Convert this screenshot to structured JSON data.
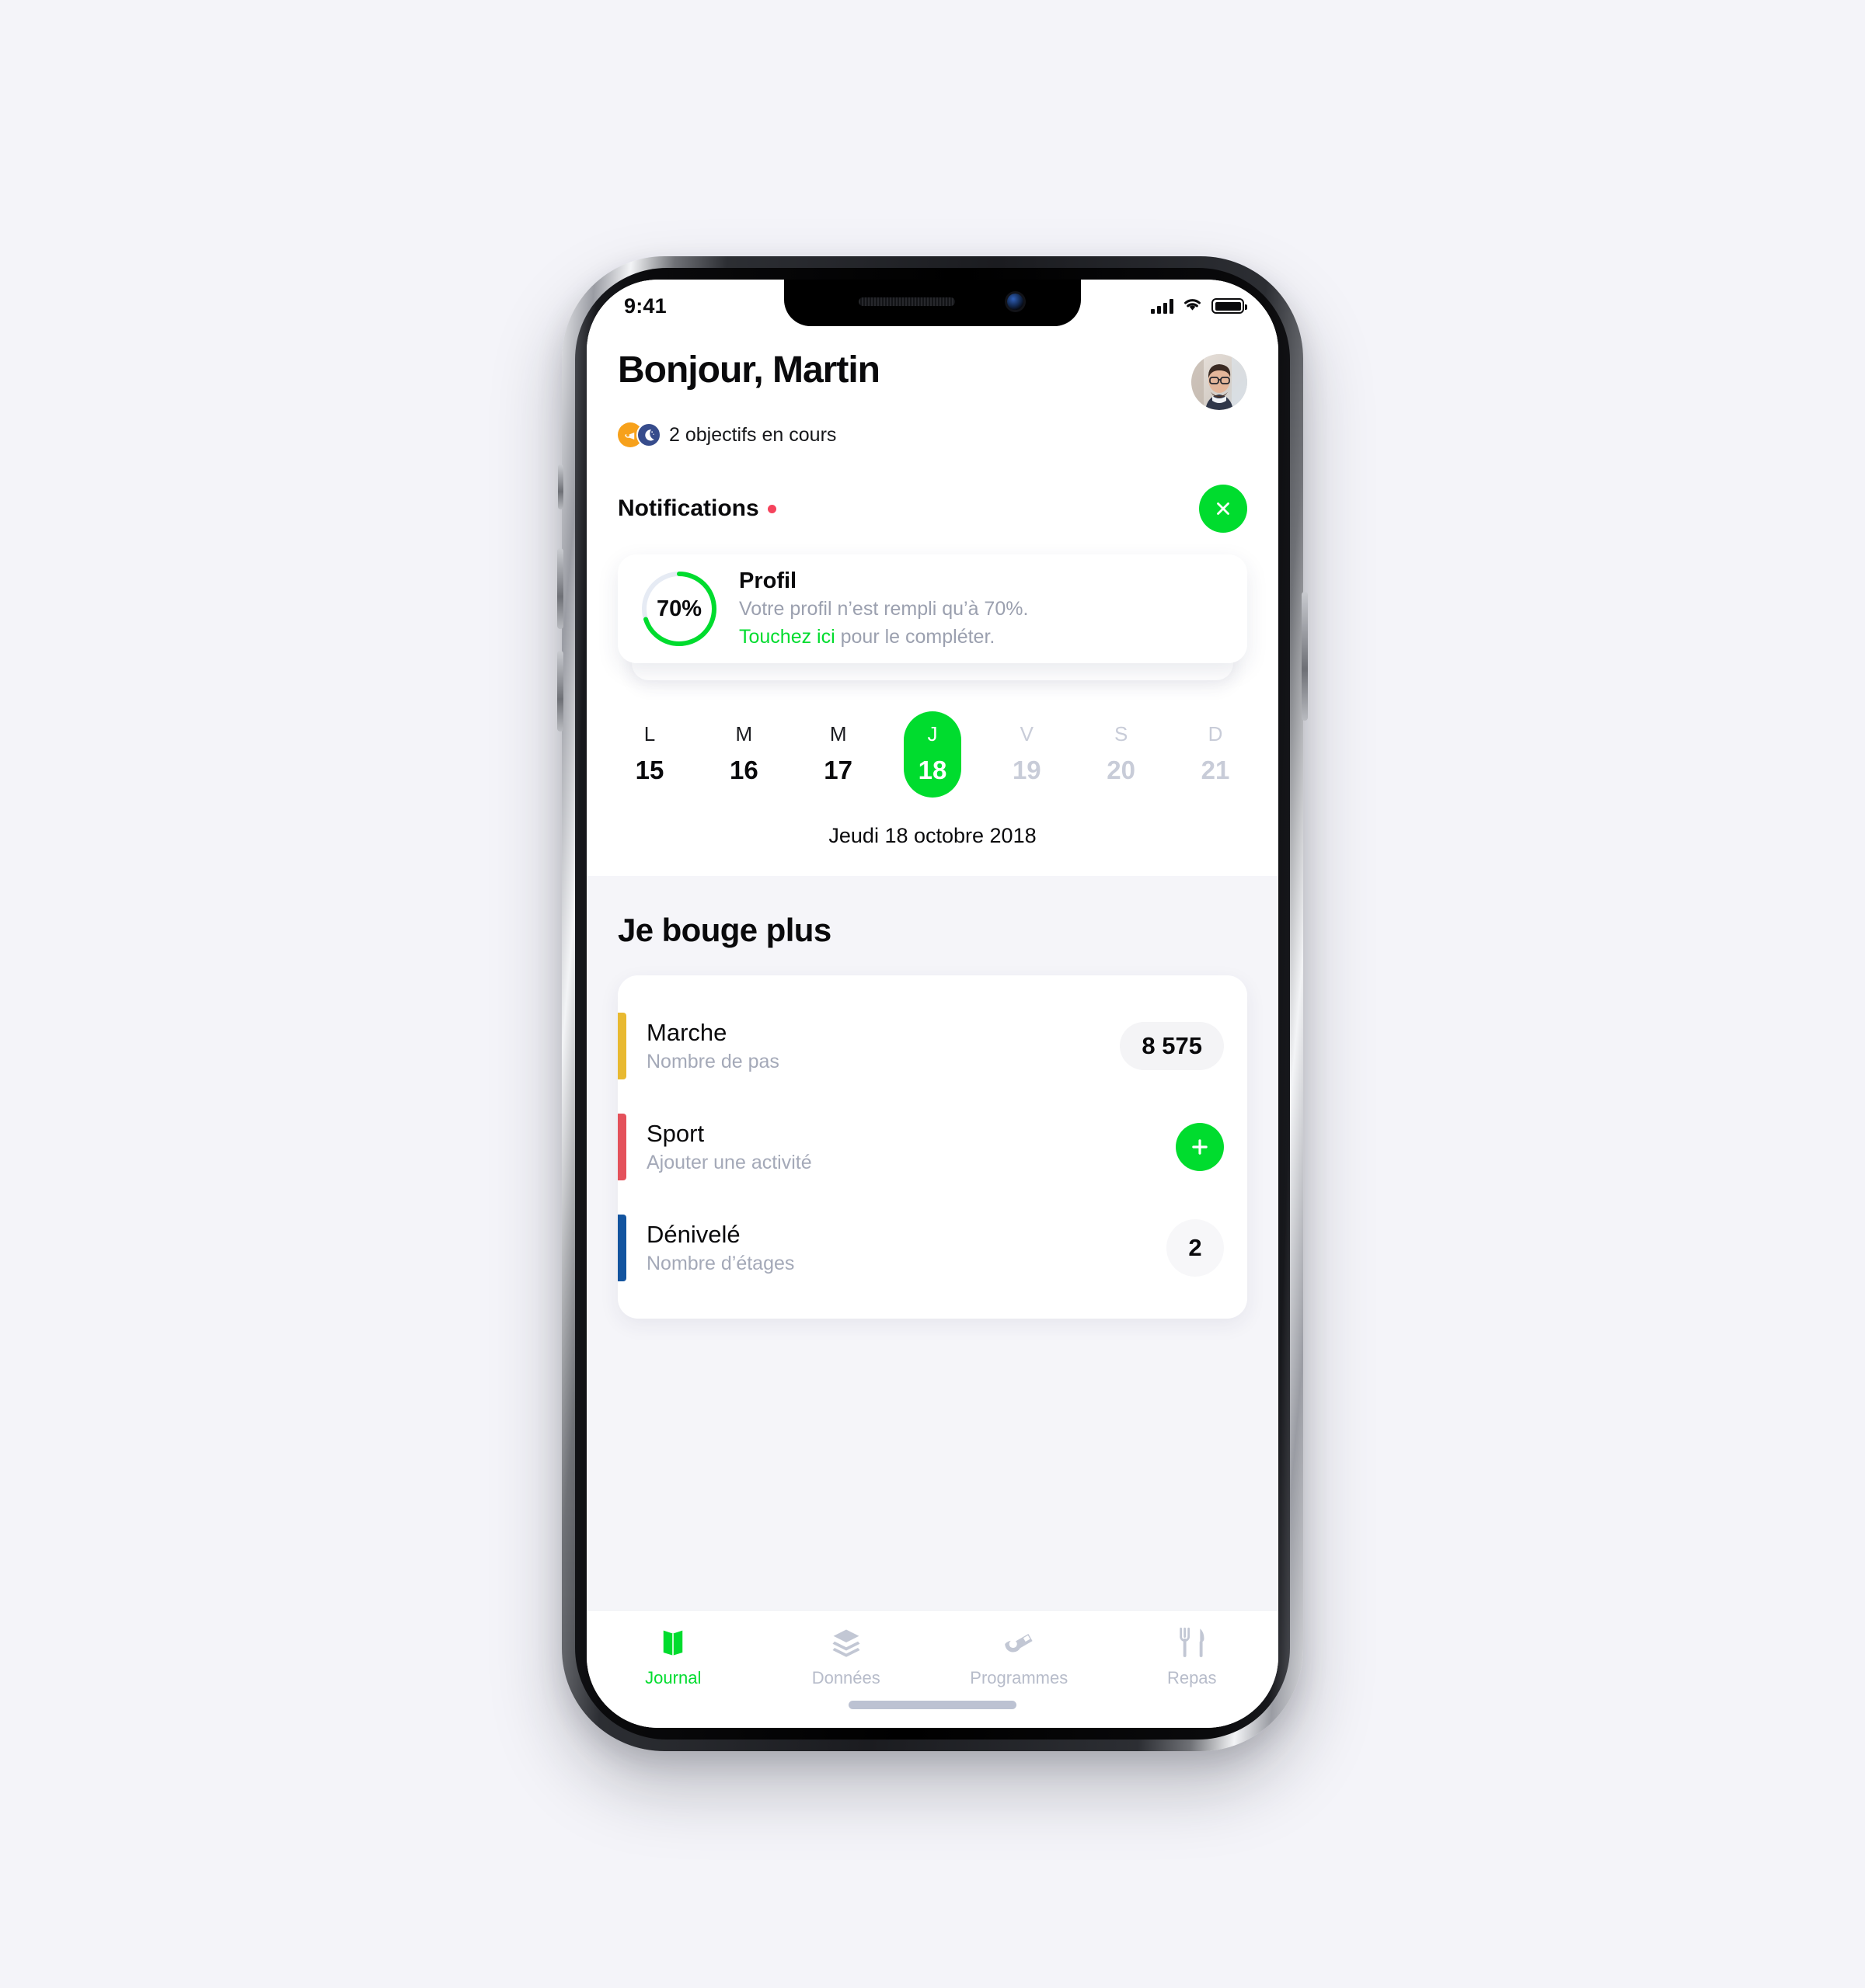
{
  "status_bar": {
    "time": "9:41",
    "signal_icon": "signal-bars-icon",
    "wifi_icon": "wifi-icon",
    "battery_icon": "battery-full-icon"
  },
  "header": {
    "greeting": "Bonjour, Martin",
    "avatar_name": "user-avatar",
    "goals_text": "2 objectifs en cours",
    "goal_badges": [
      {
        "name": "activity-goal-badge",
        "color": "#F7A11B",
        "icon": "whistle-icon"
      },
      {
        "name": "sleep-goal-badge",
        "color": "#374C8C",
        "icon": "moon-stars-icon"
      }
    ]
  },
  "notifications": {
    "title": "Notifications",
    "has_unread": true,
    "unread_dot_color": "#F5435C",
    "close_icon": "close-icon",
    "card": {
      "progress_percent": 70,
      "progress_label": "70%",
      "title": "Profil",
      "line1": "Votre profil n’est rempli qu’à 70%.",
      "link_text": "Touchez ici",
      "line2_rest": " pour le compléter.",
      "ring_color": "#00DC2E",
      "ring_track_color": "#e6ebf4"
    }
  },
  "calendar": {
    "days": [
      {
        "dow": "L",
        "num": "15",
        "state": "past"
      },
      {
        "dow": "M",
        "num": "16",
        "state": "past"
      },
      {
        "dow": "M",
        "num": "17",
        "state": "past"
      },
      {
        "dow": "J",
        "num": "18",
        "state": "selected"
      },
      {
        "dow": "V",
        "num": "19",
        "state": "future"
      },
      {
        "dow": "S",
        "num": "20",
        "state": "future"
      },
      {
        "dow": "D",
        "num": "21",
        "state": "future"
      }
    ],
    "selected_full_date": "Jeudi 18 octobre 2018",
    "selected_color": "#00DC2E"
  },
  "main": {
    "section_title": "Je bouge plus",
    "activities": [
      {
        "name": "Marche",
        "subtitle": "Nombre de pas",
        "bar_color": "#E8B931",
        "value": "8 575",
        "control": "pill"
      },
      {
        "name": "Sport",
        "subtitle": "Ajouter une activité",
        "bar_color": "#E4515B",
        "value": "",
        "control": "add",
        "add_icon": "plus-icon"
      },
      {
        "name": "Dénivelé",
        "subtitle": "Nombre d’étages",
        "bar_color": "#13549F",
        "value": "2",
        "control": "circle"
      }
    ]
  },
  "tabbar": {
    "tabs": [
      {
        "label": "Journal",
        "icon": "open-book-icon",
        "active": true
      },
      {
        "label": "Données",
        "icon": "layers-icon",
        "active": false
      },
      {
        "label": "Programmes",
        "icon": "whistle-icon",
        "active": false
      },
      {
        "label": "Repas",
        "icon": "cutlery-icon",
        "active": false
      }
    ],
    "active_color": "#00DC2E",
    "inactive_color": "#b7bcca"
  }
}
